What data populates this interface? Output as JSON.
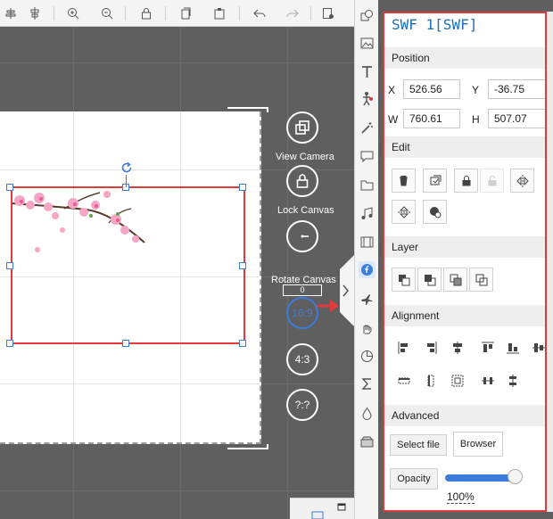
{
  "toolbar": {
    "buttons": [
      "align-center-icon",
      "distribute-icon",
      "zoom-in-icon",
      "zoom-out-icon",
      "lock-icon",
      "copy-icon",
      "paste-icon",
      "undo-icon",
      "redo-icon",
      "clear-icon"
    ]
  },
  "canvas": {
    "camera_buttons": {
      "view_camera": "View Camera",
      "lock_canvas": "Lock Canvas",
      "rotate_canvas": "Rotate Canvas",
      "rotate_value": "0",
      "ratio_16_9": "16:9",
      "ratio_4_3": "4:3",
      "ratio_custom": "?:?"
    }
  },
  "sidebar_icons": [
    "shape-icon",
    "image-icon",
    "text-icon",
    "character-icon",
    "magic-wand-icon",
    "speech-bubble-icon",
    "folder-icon",
    "music-icon",
    "video-icon",
    "swf-icon",
    "plane-icon",
    "hand-draw-icon",
    "pie-chart-icon",
    "formula-icon",
    "drop-icon",
    "box-icon"
  ],
  "panel": {
    "title": "SWF 1[SWF]",
    "position": {
      "heading": "Position",
      "x_label": "X",
      "x_value": "526.56",
      "y_label": "Y",
      "y_value": "-36.75",
      "w_label": "W",
      "w_value": "760.61",
      "h_label": "H",
      "h_value": "507.07"
    },
    "edit": {
      "heading": "Edit"
    },
    "layer": {
      "heading": "Layer"
    },
    "alignment": {
      "heading": "Alignment"
    },
    "advanced": {
      "heading": "Advanced",
      "select_file": "Select file",
      "browser": "Browser",
      "opacity_label": "Opacity",
      "opacity_value": "100%",
      "opacity_level": 1.0
    }
  },
  "colors": {
    "accent": "#1a6dbd",
    "highlight": "#e03a3a",
    "handle": "#3b7ddd"
  }
}
